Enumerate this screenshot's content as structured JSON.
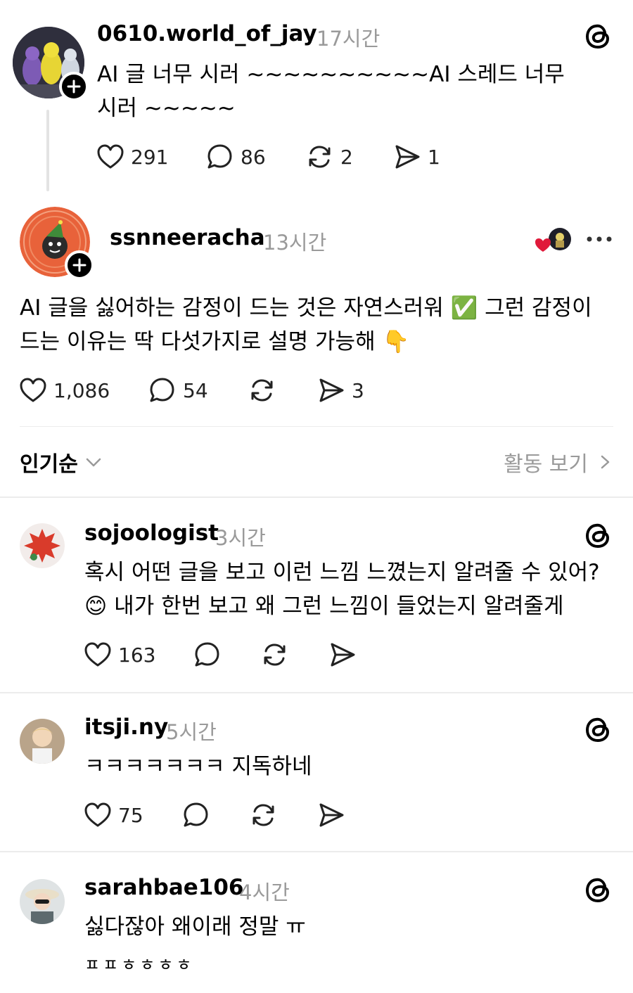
{
  "thread_post": {
    "username": "0610.world_of_jay",
    "time": "17시간",
    "text": "AI 글 너무 시러 ~~~~~~~~~~AI 스레드 너무 시러 ~~~~~",
    "likes": "291",
    "comments": "86",
    "reposts": "2",
    "shares": "1",
    "avatar_icon": "teletubbies-avatar"
  },
  "reply_post": {
    "username": "ssnneeracha",
    "time": "13시간",
    "text": "AI 글을 싫어하는 감정이 드는 것은 자연스러워 ✅ 그런 감정이 드는 이유는 딱 다섯가지로 설명 가능해 👇",
    "likes": "1,086",
    "comments": "54",
    "shares": "3",
    "liked_by_icon": "heart-with-avatar"
  },
  "sort_bar": {
    "sort_label": "인기순",
    "activity_label": "활동 보기"
  },
  "comments": [
    {
      "username": "sojoologist",
      "time": "3시간",
      "text": "혹시 어떤 글을 보고 이런 느낌 느꼈는지 알려줄 수 있어? 😊 내가 한번 보고 왜 그런 느낌이 들었는지 알려줄게",
      "likes": "163"
    },
    {
      "username": "itsji.ny",
      "time": "5시간",
      "text": "ㅋㅋㅋㅋㅋㅋㅋ 지독하네",
      "likes": "75"
    },
    {
      "username": "sarahbae106",
      "time": "4시간",
      "text": "싫다잖아 왜이래 정말 ㅠ",
      "text2": "ㅍㅍㅎㅎㅎㅎ"
    }
  ],
  "colors": {
    "muted": "#9a9a9a",
    "divider": "#ececec",
    "heart_red": "#e0193a"
  }
}
